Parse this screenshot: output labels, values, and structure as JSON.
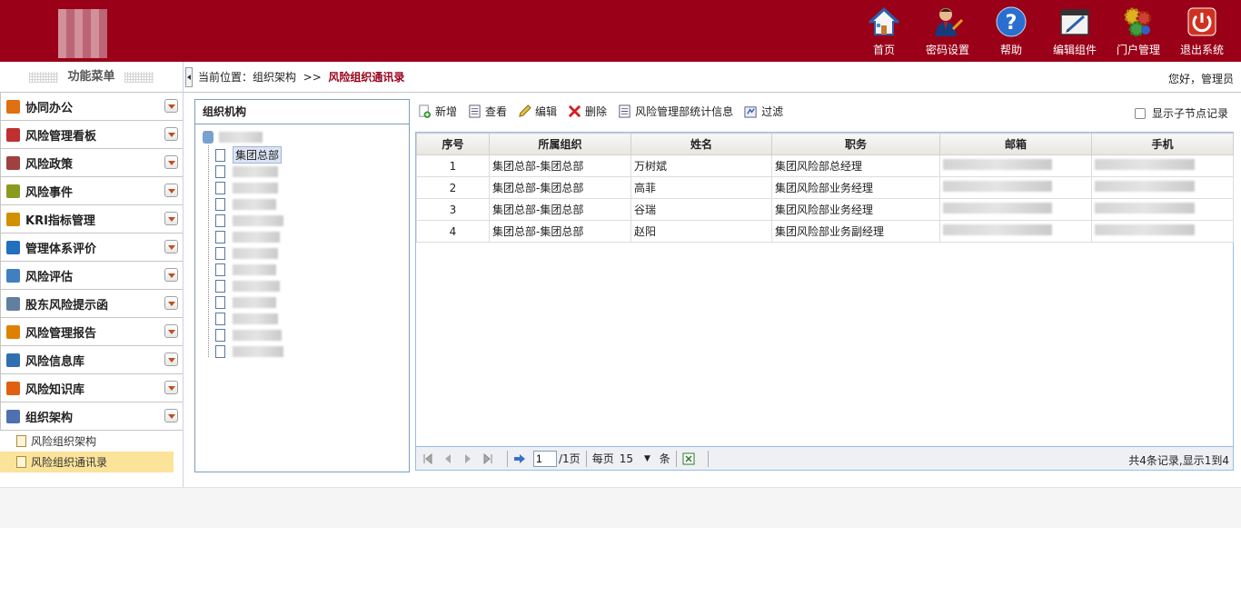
{
  "topnav": [
    {
      "label": "首页",
      "icon": "home-icon"
    },
    {
      "label": "密码设置",
      "icon": "user-key-icon"
    },
    {
      "label": "帮助",
      "icon": "help-icon"
    },
    {
      "label": "编辑组件",
      "icon": "edit-component-icon"
    },
    {
      "label": "门户管理",
      "icon": "gears-icon"
    },
    {
      "label": "退出系统",
      "icon": "power-icon"
    }
  ],
  "sidebar": {
    "title": "功能菜单",
    "items": [
      {
        "label": "协同办公",
        "color": "#e07010"
      },
      {
        "label": "风险管理看板",
        "color": "#c03030"
      },
      {
        "label": "风险政策",
        "color": "#a04040"
      },
      {
        "label": "风险事件",
        "color": "#8a9a20"
      },
      {
        "label": "KRI指标管理",
        "color": "#d09000"
      },
      {
        "label": "管理体系评价",
        "color": "#2070c0"
      },
      {
        "label": "风险评估",
        "color": "#4080c0"
      },
      {
        "label": "股东风险提示函",
        "color": "#6080a0"
      },
      {
        "label": "风险管理报告",
        "color": "#e08000"
      },
      {
        "label": "风险信息库",
        "color": "#3070b0"
      },
      {
        "label": "风险知识库",
        "color": "#e06010"
      },
      {
        "label": "组织架构",
        "color": "#5070b0"
      }
    ],
    "subitems": [
      "风险组织架构",
      "风险组织通讯录"
    ]
  },
  "breadcrumb": {
    "prefix": "当前位置：组织架构",
    "sep": ">>",
    "current": "风险组织通讯录"
  },
  "greeting": "您好，管理员",
  "tree": {
    "title": "组织机构",
    "selected": "集团总部"
  },
  "toolbar": {
    "add": "新增",
    "view": "查看",
    "edit": "编辑",
    "delete": "删除",
    "stats": "风险管理部统计信息",
    "filter": "过滤",
    "show_children": "显示子节点记录"
  },
  "grid": {
    "columns": [
      "序号",
      "所属组织",
      "姓名",
      "职务",
      "邮箱",
      "手机"
    ],
    "rows": [
      {
        "no": "1",
        "org": "集团总部-集团总部",
        "name": "万树斌",
        "title": "集团风险部总经理"
      },
      {
        "no": "2",
        "org": "集团总部-集团总部",
        "name": "高菲",
        "title": "集团风险部业务经理"
      },
      {
        "no": "3",
        "org": "集团总部-集团总部",
        "name": "谷瑞",
        "title": "集团风险部业务经理"
      },
      {
        "no": "4",
        "org": "集团总部-集团总部",
        "name": "赵阳",
        "title": "集团风险部业务副经理"
      }
    ]
  },
  "pager": {
    "page": "1",
    "pages": "/1页",
    "per_label": "每页",
    "per_value": "15",
    "per_unit": "条",
    "total": "共4条记录,显示1到4"
  }
}
